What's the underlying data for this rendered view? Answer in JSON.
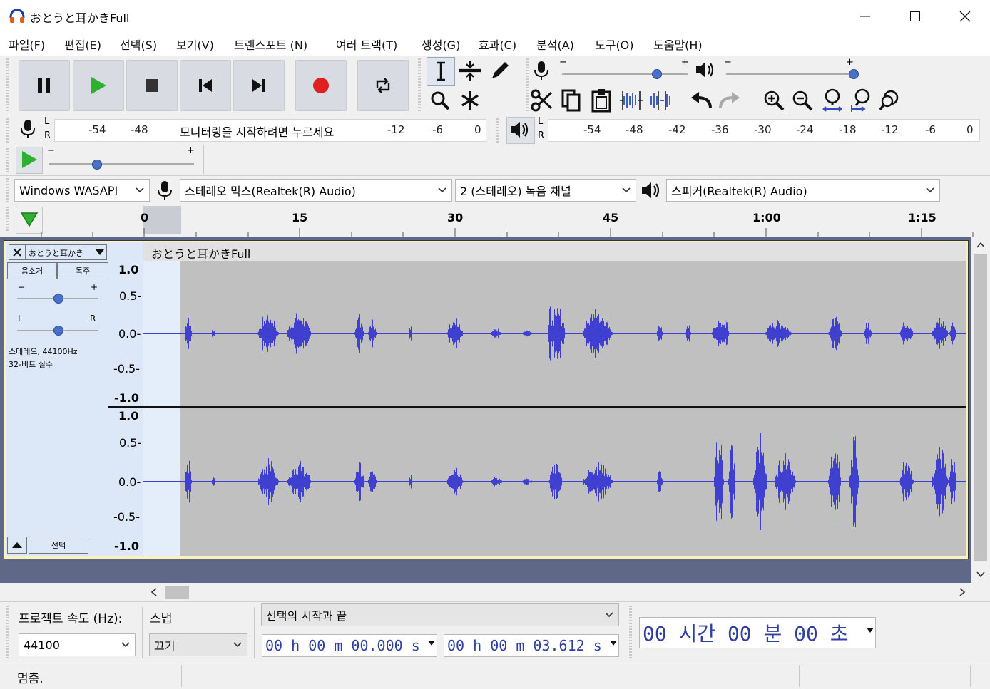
{
  "window": {
    "title": "おとうと耳かきFull"
  },
  "menu": [
    "파일(F)",
    "편집(E)",
    "선택(S)",
    "보기(V)",
    "트랜스포트 (N)",
    "여러 트랙(T)",
    "생성(G)",
    "효과(C)",
    "분석(A)",
    "도구(O)",
    "도움말(H)"
  ],
  "transport": {
    "buttons": [
      "pause-icon",
      "play-icon",
      "stop-icon",
      "skip-start-icon",
      "skip-end-icon",
      "record-icon",
      "loop-icon"
    ]
  },
  "meters": {
    "record": {
      "l": "L",
      "r": "R",
      "ticks": [
        "-54",
        "-48",
        "-12",
        "-6",
        "0"
      ],
      "prompt": "모니터링을 시작하려면 누르세요"
    },
    "play": {
      "l": "L",
      "r": "R",
      "ticks": [
        "-54",
        "-48",
        "-42",
        "-36",
        "-30",
        "-24",
        "-18",
        "-12",
        "-6",
        "0"
      ]
    }
  },
  "sliders": {
    "minus": "−",
    "plus": "+",
    "mic_level": 0.75,
    "speaker_level": 1.0,
    "play_speed": 0.33
  },
  "devices": {
    "host": "Windows WASAPI",
    "recording": "스테레오 믹스(Realtek(R) Audio)",
    "channels": "2 (스테레오) 녹음 채널",
    "playback": "스피커(Realtek(R) Audio)"
  },
  "timeline": {
    "labels": [
      "0",
      "15",
      "30",
      "45",
      "1:00",
      "1:15"
    ]
  },
  "track": {
    "name": "おとうと耳かき",
    "clip_title": "おとうと耳かきFull",
    "mute": "음소거",
    "solo": "독주",
    "gain_minus": "−",
    "gain_plus": "+",
    "pan_l": "L",
    "pan_r": "R",
    "gain_level": 0.5,
    "pan_level": 0.5,
    "info_line1": "스테레오, 44100Hz",
    "info_line2": "32-비트 실수",
    "select": "선택",
    "scale": [
      "1.0",
      "0.5-",
      "0.0-",
      "-0.5-",
      "-1.0"
    ]
  },
  "bottom": {
    "rate_label": "프로젝트 속도 (Hz):",
    "snap_label": "스냅",
    "rate_value": "44100",
    "snap_value": "끄기",
    "selection_mode": "선택의 시작과 끝",
    "sel_start": "00 h 00 m 00.000 s",
    "sel_end": "00 h 00 m 03.612 s",
    "position": "00 시간 00 분 00 초"
  },
  "status": {
    "text": "멈춤."
  },
  "colors": {
    "wave": "#3f3fd0",
    "accent": "#4a70c8",
    "record": "#e02020",
    "play": "#30b030"
  }
}
